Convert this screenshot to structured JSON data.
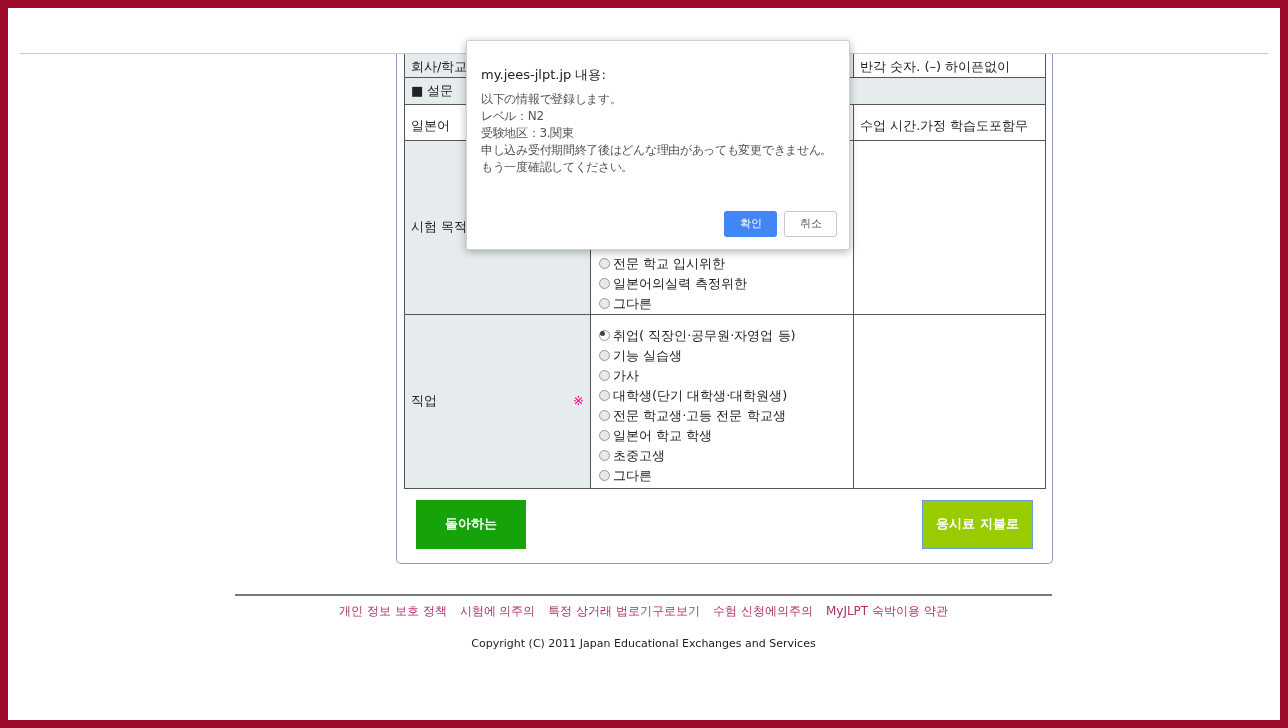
{
  "table": {
    "row_company": {
      "label": "회사/학교",
      "note": "반각 숫자. (–) 하이픈없이"
    },
    "survey_heading": "■ 설문",
    "header_row": {
      "column_1": "일본어",
      "column_3": "수업 시간.가정 학습도포함무"
    },
    "purpose": {
      "label": "시험 목적",
      "options": [
        {
          "label": "전문 학교 입시위한",
          "selected": false
        },
        {
          "label": "일본어의실력 측정위한",
          "selected": false
        },
        {
          "label": "그다른",
          "selected": false
        }
      ]
    },
    "occupation": {
      "label": "직업",
      "required_mark": "※",
      "options": [
        {
          "label": "취업( 직장인·공무원·자영업 등)",
          "selected": true
        },
        {
          "label": "기능 실습생",
          "selected": false
        },
        {
          "label": "가사",
          "selected": false
        },
        {
          "label": "대학생(단기 대학생·대학원생)",
          "selected": false
        },
        {
          "label": "전문 학교생·고등 전문 학교생",
          "selected": false
        },
        {
          "label": "일본어 학교 학생",
          "selected": false
        },
        {
          "label": "초중고생",
          "selected": false
        },
        {
          "label": "그다른",
          "selected": false
        }
      ]
    }
  },
  "buttons": {
    "back": "돌아하는",
    "pay": "응시료 지불로"
  },
  "footer": {
    "links": [
      "개인 정보 보호 정책",
      "시험에 의주의",
      "특정 상거래 법로기구로보기",
      "수험 신청에의주의",
      "MyJLPT 숙박이용 약관"
    ],
    "copyright": "Copyright (C) 2011 Japan Educational Exchanges and Services"
  },
  "dialog": {
    "title": "my.jees-jlpt.jp 내용:",
    "lines": [
      "以下の情報で登録します。",
      "レベル：N2",
      "受験地区：3.関東",
      "申し込み受付期間終了後はどんな理由があっても変更できません。",
      "もう一度確認してください。"
    ],
    "ok": "확인",
    "cancel": "취소"
  }
}
